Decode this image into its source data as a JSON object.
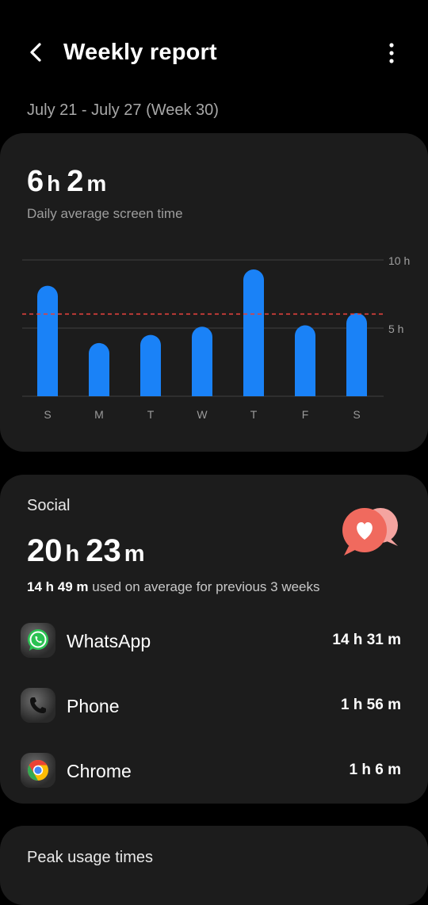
{
  "header": {
    "title": "Weekly report",
    "back_icon": "chevron-left-icon",
    "more_icon": "more-vertical-icon"
  },
  "date_range": "July 21 - July 27 (Week 30)",
  "summary": {
    "hours": "6",
    "minutes": "2",
    "hour_unit": "h",
    "minute_unit": "m",
    "label": "Daily average screen time"
  },
  "chart_data": {
    "type": "bar",
    "categories": [
      "S",
      "M",
      "T",
      "W",
      "T",
      "F",
      "S"
    ],
    "values": [
      8.1,
      3.9,
      4.5,
      5.1,
      9.3,
      5.2,
      6.1
    ],
    "average": 6.03,
    "ylim": [
      0,
      10
    ],
    "y_ticks": [
      "10 h",
      "5 h"
    ],
    "y_tick_values": [
      10,
      5
    ],
    "bar_color": "#1a82f7",
    "average_line_color": "#e0403c"
  },
  "social": {
    "label": "Social",
    "hours": "20",
    "minutes": "23",
    "hour_unit": "h",
    "minute_unit": "m",
    "prev_avg_value": "14 h 49 m",
    "prev_avg_text": " used on average for previous 3 weeks",
    "badge_icon": "heart-chat-bubble-icon",
    "apps": [
      {
        "name": "WhatsApp",
        "time": "14 h 31 m",
        "icon": "whatsapp-icon"
      },
      {
        "name": "Phone",
        "time": "1 h 56 m",
        "icon": "phone-icon"
      },
      {
        "name": "Chrome",
        "time": "1 h 6 m",
        "icon": "chrome-icon"
      }
    ]
  },
  "peak": {
    "label": "Peak usage times"
  }
}
